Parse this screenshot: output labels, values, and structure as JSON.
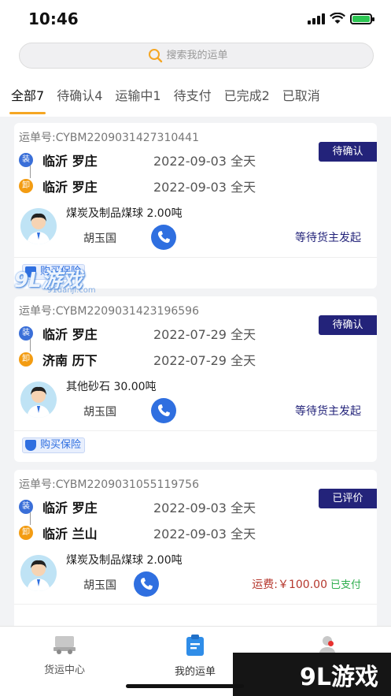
{
  "status_bar": {
    "time": "10:46"
  },
  "search": {
    "placeholder": "搜索我的运单"
  },
  "tabs": [
    {
      "label": "全部7",
      "active": true
    },
    {
      "label": "待确认4"
    },
    {
      "label": "运输中1"
    },
    {
      "label": "待支付"
    },
    {
      "label": "已完成2"
    },
    {
      "label": "已取消"
    }
  ],
  "orders": [
    {
      "order_no": "运单号:CYBM2209031427310441",
      "badge": "待确认",
      "load_tag": "装",
      "unload_tag": "卸",
      "from_city": "临沂 罗庄",
      "from_date": "2022-09-03 全天",
      "to_city": "临沂 罗庄",
      "to_date": "2022-09-03 全天",
      "cargo": "煤炭及制品煤球  2.00吨",
      "driver": "胡玉国",
      "status": "等待货主发起",
      "insurance": "购买保险"
    },
    {
      "order_no": "运单号:CYBM2209031423196596",
      "badge": "待确认",
      "load_tag": "装",
      "unload_tag": "卸",
      "from_city": "临沂 罗庄",
      "from_date": "2022-07-29 全天",
      "to_city": "济南 历下",
      "to_date": "2022-07-29 全天",
      "cargo": "其他砂石  30.00吨",
      "driver": "胡玉国",
      "status": "等待货主发起",
      "insurance": "购买保险"
    },
    {
      "order_no": "运单号:CYBM2209031055119756",
      "badge": "已评价",
      "load_tag": "装",
      "unload_tag": "卸",
      "from_city": "临沂 罗庄",
      "from_date": "2022-09-03 全天",
      "to_city": "临沂 兰山",
      "to_date": "2022-09-03 全天",
      "cargo": "煤炭及制品煤球  2.00吨",
      "driver": "胡玉国",
      "fee": "运费:￥100.00",
      "paid": "已支付"
    }
  ],
  "bottom_nav": [
    {
      "label": "货运中心",
      "icon": "truck-icon"
    },
    {
      "label": "我的运单",
      "icon": "waybill-icon",
      "active": true
    },
    {
      "label": "",
      "icon": "profile-icon"
    }
  ],
  "watermark": {
    "top": "9L游戏",
    "top_sub": "91danji.com",
    "bottom": "9L游戏"
  },
  "colors": {
    "accent": "#f5a623",
    "badge": "#23237a",
    "phone": "#2f6fe0",
    "fee": "#b5362c",
    "paid": "#2fae4e"
  }
}
